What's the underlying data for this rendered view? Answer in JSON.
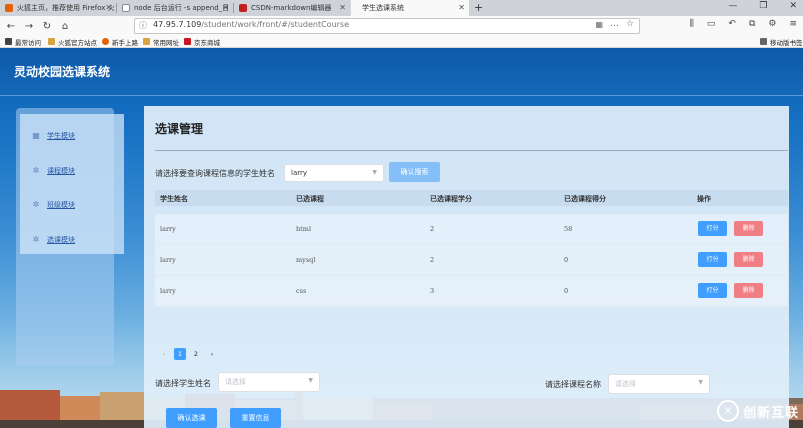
{
  "browser": {
    "tabs": [
      {
        "label": "火狐主页，推荐使用 Firefox 火",
        "color": "#e66000"
      },
      {
        "label": "node 后台运行 -s append_日",
        "color": "#888888"
      },
      {
        "label": "CSDN-markdown编辑器",
        "color": "#c32121"
      },
      {
        "label": "学生选课系统",
        "color": "#ffffff"
      }
    ],
    "url_host": "47.95.7.109",
    "url_path": "/student/work/front/#/studentCourse",
    "bookmarks": [
      "最常访问",
      "火狐官方站点",
      "新手上路",
      "常用网址",
      "京东商城"
    ],
    "mobile_bookmarks": "移动版书签"
  },
  "app": {
    "title": "灵动校园选课系统",
    "accent": "#409eff",
    "danger": "#f07f85"
  },
  "sidebar": {
    "items": [
      {
        "label": "学生模块",
        "icon": "grid-icon"
      },
      {
        "label": "课程模块",
        "icon": "gear-icon"
      },
      {
        "label": "班级模块",
        "icon": "gear-icon"
      },
      {
        "label": "选课模块",
        "icon": "gear-icon"
      }
    ]
  },
  "main": {
    "title": "选课管理",
    "query_label": "请选择要查询课程信息的学生姓名",
    "query_value": "larry",
    "query_button": "确认搜索",
    "columns": [
      "学生姓名",
      "已选课程",
      "已选课程学分",
      "已选课程得分",
      "操作"
    ],
    "rows": [
      {
        "name": "larry",
        "course": "html",
        "credit": "2",
        "score": "58"
      },
      {
        "name": "larry",
        "course": "mysql",
        "credit": "2",
        "score": "0"
      },
      {
        "name": "larry",
        "course": "css",
        "credit": "3",
        "score": "0"
      }
    ],
    "row_actions": {
      "edit": "打分",
      "delete": "删除"
    },
    "pagination": {
      "prev": "‹",
      "pages": [
        "1",
        "2"
      ],
      "next": "›",
      "current": "1"
    },
    "student_label": "请选择学生姓名",
    "student_placeholder": "请选择",
    "course_label": "请选择课程名称",
    "course_placeholder": "请选择",
    "confirm_button": "确认选课",
    "reset_button": "重置信息"
  },
  "watermark": {
    "text": "创新互联"
  }
}
